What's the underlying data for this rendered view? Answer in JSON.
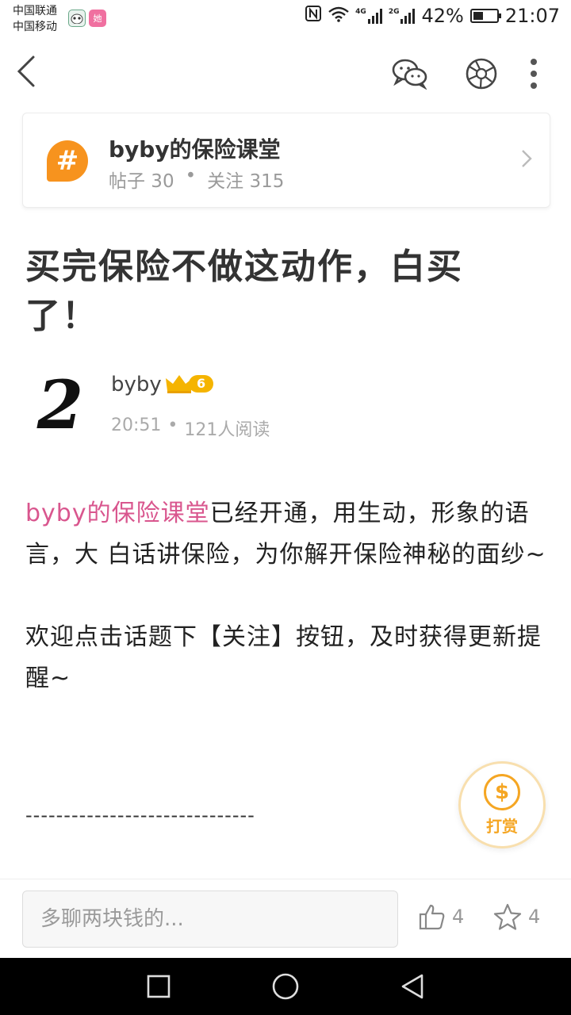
{
  "status_bar": {
    "carrier_1": "中国联通",
    "carrier_2": "中国移动",
    "app_icon_label": "她",
    "net_1": "4G",
    "net_2": "2G",
    "battery": "42%",
    "battery_level": 0.42,
    "time": "21:07"
  },
  "topic": {
    "icon_glyph": "#",
    "name": "byby的保险课堂",
    "posts_label": "帖子 30",
    "dot": "•",
    "follow_label": "关注 315"
  },
  "article": {
    "title": "买完保险不做这动作，白买了！",
    "author": {
      "avatar_glyph": "2",
      "name": "byby",
      "level": "6"
    },
    "time": "20:51",
    "dot": "•",
    "reads": "121人阅读",
    "paragraph_1_link": "byby的保险课堂",
    "paragraph_1_rest": "已经开通，用生动，形象的语言，大 白话讲保险，为你解开保险神秘的面纱~",
    "paragraph_2": "欢迎点击话题下【关注】按钮，及时获得更新提醒~",
    "divider": "------------------------------"
  },
  "tip_button": {
    "coin": "$",
    "label": "打赏"
  },
  "bottom_bar": {
    "comment_placeholder": "多聊两块钱的...",
    "like_count": "4",
    "favorite_count": "4"
  },
  "colors": {
    "accent_orange": "#f7931e",
    "link_pink": "#d9568e",
    "tip_gold": "#f5a623"
  }
}
